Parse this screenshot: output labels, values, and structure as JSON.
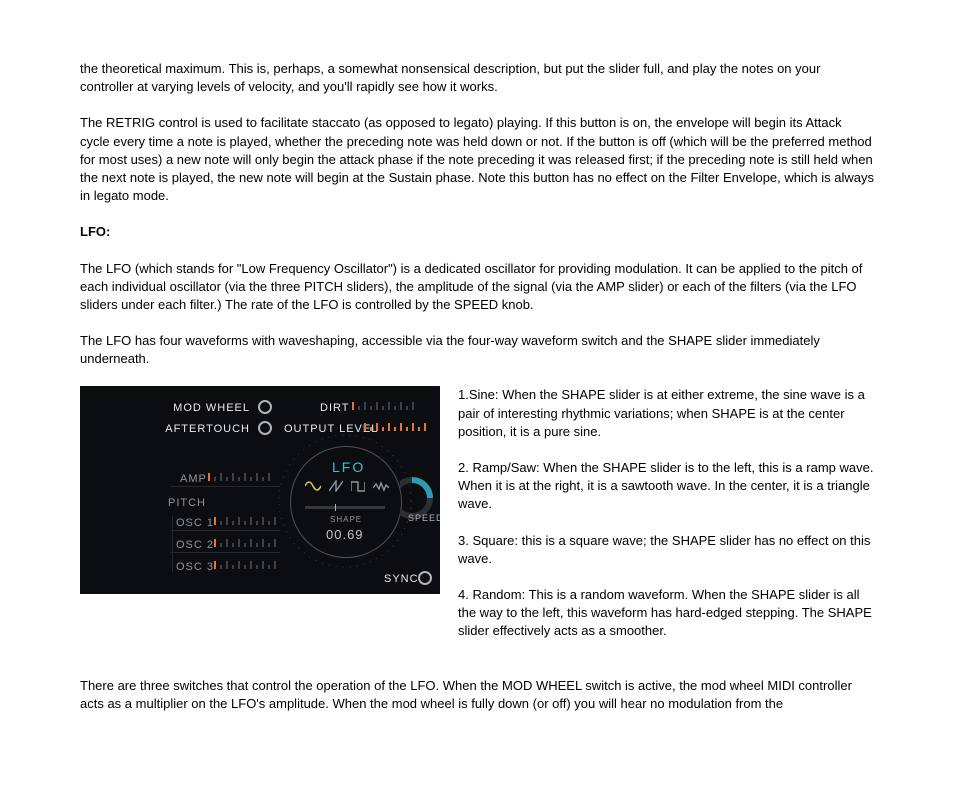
{
  "paragraphs": {
    "p1": "the theoretical maximum. This is, perhaps, a somewhat nonsensical description, but put the slider full, and play the notes on your controller at varying levels of velocity, and you'll rapidly see how it works.",
    "p2": "The RETRIG control is used to facilitate staccato (as opposed to legato) playing. If this button is on, the envelope will begin its Attack cycle every time a note is played, whether the preceding note was held down or not. If the button is off (which will be the preferred method for most uses) a new note will only begin the attack phase if the note preceding it was released first; if the preceding note is still held when the next note is played, the new note will begin at the Sustain phase. Note this button has no effect on the Filter Envelope, which is always in legato mode.",
    "h_lfo": "LFO:",
    "p3": "The LFO (which stands for \"Low Frequency Oscillator\") is a dedicated oscillator for providing modulation. It can be applied to the pitch of each individual oscillator (via the three PITCH sliders), the amplitude of the signal (via the AMP slider) or each of the filters (via the LFO sliders under each filter.) The rate of the LFO is controlled by the SPEED knob.",
    "p4": "The LFO has four waveforms with waveshaping, accessible via the four-way waveform switch and the SHAPE slider immediately underneath.",
    "li1": "1.Sine: When the SHAPE slider is at either extreme, the sine wave is a pair of interesting rhythmic variations; when SHAPE is at the center position, it is a pure sine.",
    "li2": "2. Ramp/Saw: When the SHAPE slider is to the left, this is a ramp wave. When it is at the right, it is a sawtooth wave. In the center, it is a triangle wave.",
    "li3": "3. Square: this is a square wave; the SHAPE slider has no effect on this wave.",
    "li4": "4. Random: This is a random waveform. When the SHAPE slider is all the way to the left, this waveform has hard-edged stepping. The SHAPE slider effectively acts as a smoother.",
    "p5": "There are three switches that control the operation of the LFO. When the MOD WHEEL switch is active, the mod wheel MIDI controller acts as a multiplier on the LFO's amplitude. When the mod wheel is fully down (or off) you will hear no modulation from the"
  },
  "panel": {
    "mod_wheel": "MOD WHEEL",
    "aftertouch": "AFTERTOUCH",
    "dirt": "DIRT",
    "output_level": "OUTPUT LEVEL",
    "amp": "AMP",
    "pitch": "PITCH",
    "osc1": "OSC 1",
    "osc2": "OSC 2",
    "osc3": "OSC 3",
    "lfo": "LFO",
    "shape": "SHAPE",
    "shape_value": "00.69",
    "speed": "SPEED",
    "sync": "SYNC"
  }
}
